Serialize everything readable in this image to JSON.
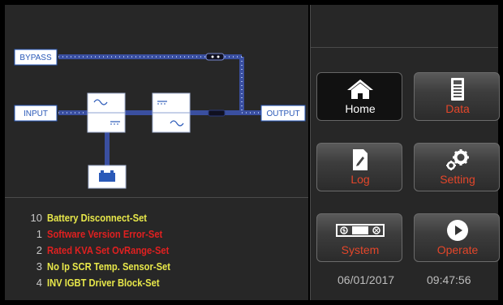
{
  "diagram": {
    "bypass_label": "BYPASS",
    "input_label": "INPUT",
    "output_label": "OUTPUT"
  },
  "alarms": [
    {
      "num": "10",
      "text": "Battery Disconnect-Set",
      "color": "#e8e84a"
    },
    {
      "num": "1",
      "text": "Software Version Error-Set",
      "color": "#e02020"
    },
    {
      "num": "2",
      "text": "Rated KVA Set OvRange-Set",
      "color": "#e02020"
    },
    {
      "num": "3",
      "text": "No Ip SCR Temp. Sensor-Set",
      "color": "#e8e84a"
    },
    {
      "num": "4",
      "text": "INV IGBT Driver Block-Set",
      "color": "#e8e84a"
    }
  ],
  "nav": {
    "home": {
      "label": "Home",
      "icon": "home-icon"
    },
    "data": {
      "label": "Data",
      "icon": "battery-meter-icon"
    },
    "log": {
      "label": "Log",
      "icon": "log-edit-icon"
    },
    "setting": {
      "label": "Setting",
      "icon": "gears-icon"
    },
    "system": {
      "label": "System",
      "icon": "system-icon"
    },
    "operate": {
      "label": "Operate",
      "icon": "play-icon"
    }
  },
  "status": {
    "date": "06/01/2017",
    "time": "09:47:56"
  },
  "colors": {
    "accent": "#e3462a",
    "flow": "#3a4fa0",
    "warning": "#e8e84a",
    "error": "#e02020"
  }
}
